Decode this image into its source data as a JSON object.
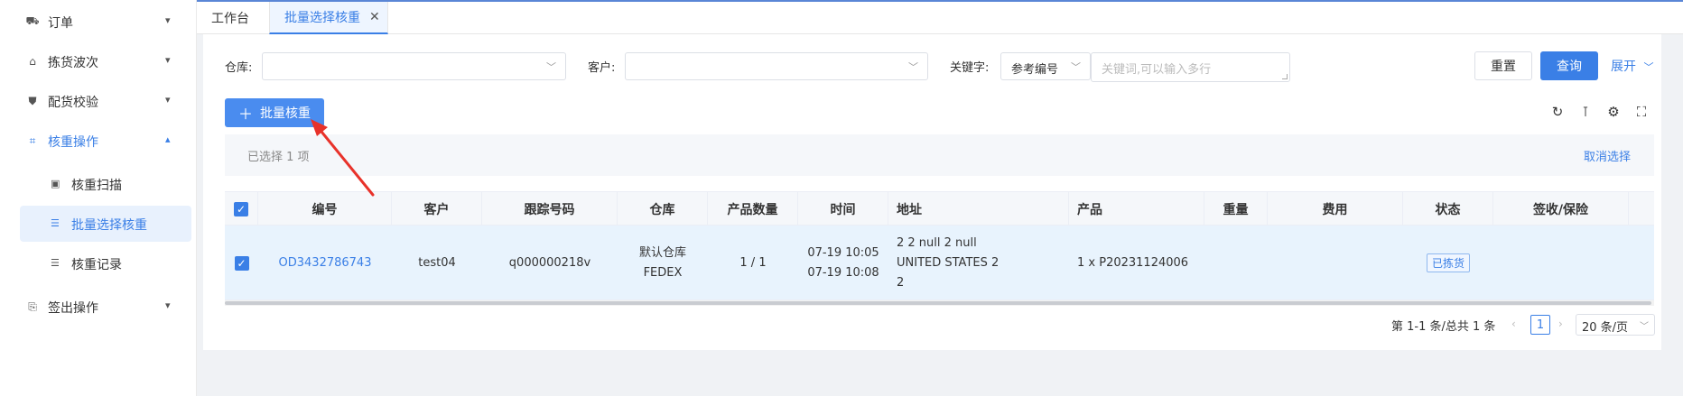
{
  "sidebar": {
    "items": [
      {
        "label": "订单",
        "icon": "truck-icon"
      },
      {
        "label": "拣货波次",
        "icon": "warehouse-icon"
      },
      {
        "label": "配货校验",
        "icon": "shield-icon"
      },
      {
        "label": "核重操作",
        "icon": "scan-icon"
      },
      {
        "label": "签出操作",
        "icon": "signout-icon"
      }
    ],
    "subitems": [
      {
        "label": "核重扫描",
        "icon": "scale-icon"
      },
      {
        "label": "批量选择核重",
        "icon": "list-icon"
      },
      {
        "label": "核重记录",
        "icon": "list-icon"
      }
    ]
  },
  "tabs": [
    {
      "label": "工作台"
    },
    {
      "label": "批量选择核重"
    }
  ],
  "filters": {
    "warehouse_label": "仓库:",
    "customer_label": "客户:",
    "keyword_label": "关键字:",
    "keyword_type": "参考编号",
    "keyword_placeholder": "关键词,可以输入多行"
  },
  "buttons": {
    "reset": "重置",
    "query": "查询",
    "expand": "展开",
    "batch": "批量核重"
  },
  "selection": {
    "text": "已选择  1  项",
    "cancel": "取消选择"
  },
  "table": {
    "headers": [
      "编号",
      "客户",
      "跟踪号码",
      "仓库",
      "产品数量",
      "时间",
      "地址",
      "产品",
      "重量",
      "费用",
      "状态",
      "签收/保险"
    ],
    "rows": [
      {
        "number": "OD3432786743",
        "customer": "test04",
        "tracking": "q000000218v",
        "warehouse_line1": "默认仓库",
        "warehouse_line2": "FEDEX",
        "qty": "1 / 1",
        "time_line1": "07-19 10:05",
        "time_line2": "07-19 10:08",
        "addr_line1": "2 2 null 2 null",
        "addr_line2": "UNITED STATES 2",
        "addr_line3": "2",
        "product": "1 x P20231124006",
        "weight": "",
        "fee": "",
        "status": "已拣货",
        "sign": ""
      }
    ]
  },
  "pagination": {
    "total": "第 1-1 条/总共 1 条",
    "current": "1",
    "page_size": "20 条/页"
  },
  "colors": {
    "accent": "#3a7fe6",
    "annotation": "#e8322a"
  }
}
